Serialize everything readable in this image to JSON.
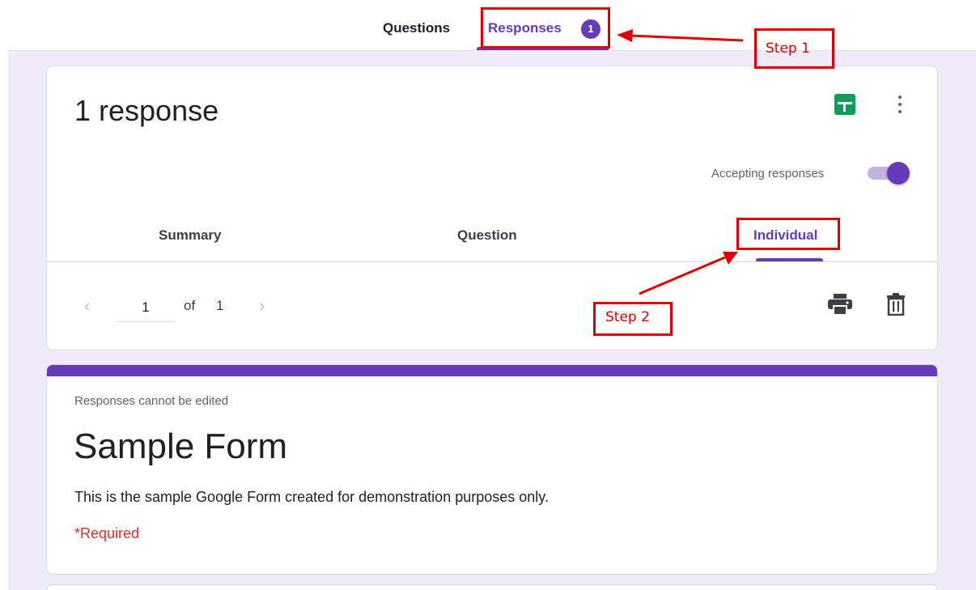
{
  "top_tabs": {
    "questions": "Questions",
    "responses": "Responses",
    "responses_badge": "1"
  },
  "summary_card": {
    "response_count": "1 response",
    "accepting_label": "Accepting responses",
    "accepting_on": true,
    "sub_tabs": [
      "Summary",
      "Question",
      "Individual"
    ],
    "active_sub_tab": "Individual",
    "pager": {
      "prev": "‹",
      "current": "1",
      "of": "of",
      "total": "1",
      "next": "›"
    },
    "icons": [
      "sheets-icon",
      "more-vert-icon",
      "print-icon",
      "trash-icon",
      "chevron-left-icon",
      "chevron-right-icon"
    ]
  },
  "form_card": {
    "note": "Responses cannot be edited",
    "title": "Sample Form",
    "description": "This is the sample Google Form created for demonstration purposes only.",
    "required": "*Required"
  },
  "annotations": {
    "step1": "Step 1",
    "step2": "Step 2"
  },
  "colors": {
    "accent": "#673ab7",
    "background": "#f0ebf8",
    "sheets_green": "#0f9d58",
    "annotation_red": "#e00000",
    "required_red": "#d93025"
  }
}
